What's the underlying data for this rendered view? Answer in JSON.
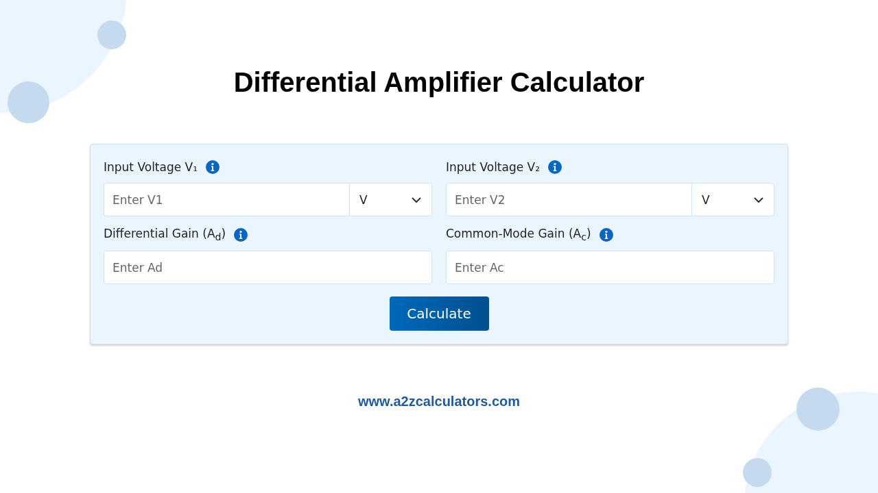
{
  "title": "Differential Amplifier Calculator",
  "fields": [
    {
      "kind": "unit",
      "label": "Input Voltage V₁",
      "placeholder": "Enter V1",
      "unit": "V"
    },
    {
      "kind": "unit",
      "label": "Input Voltage V₂",
      "placeholder": "Enter V2",
      "unit": "V"
    },
    {
      "kind": "plain",
      "label": "Differential Gain (A$_{d}$)",
      "placeholder": "Enter Ad"
    },
    {
      "kind": "plain",
      "label": "Common-Mode Gain (A$_{c}$)",
      "placeholder": "Enter Ac"
    }
  ],
  "button": "Calculate",
  "footer": "www.a2zcalculators.com"
}
